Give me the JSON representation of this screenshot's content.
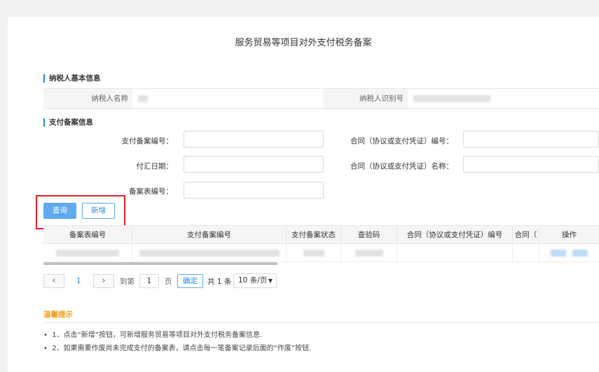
{
  "page": {
    "title": "服务贸易等项目对外支付税务备案"
  },
  "taxpayer": {
    "section_title": "纳税人基本信息",
    "name_label": "纳税人名称",
    "id_label": "纳税人识别号"
  },
  "payment": {
    "section_title": "支付备案信息",
    "fields": {
      "filing_no_label": "支付备案编号：",
      "contract_no_label": "合同（协议或支付凭证）编号：",
      "remit_date_label": "付汇日期：",
      "contract_name_label": "合同（协议或支付凭证）名称：",
      "form_no_label": "备案表编号："
    },
    "buttons": {
      "query": "查询",
      "add": "新增"
    }
  },
  "table": {
    "headers": [
      "备案表编号",
      "支付备案编号",
      "支付备案状态",
      "查验码",
      "合同（协议或支付凭证）编号",
      "合同（",
      "操作"
    ]
  },
  "pager": {
    "prev_icon": "chevron-left-icon",
    "next_icon": "chevron-right-icon",
    "current_page": "1",
    "goto_label": "到第",
    "goto_value": "1",
    "page_suffix": "页",
    "confirm": "确定",
    "total": "共 1 条",
    "page_size": "10 条/页"
  },
  "tips": {
    "title": "温馨提示",
    "items": [
      "1、点击“新增”按钮，可新增服务贸易等项目对外支付税务备案信息.",
      "2、如果需要作废尚未完成支付的备案表，请点击每一笔备案记录后面的“作废”按钮."
    ]
  },
  "colors": {
    "accent": "#5ea9f0",
    "highlight": "#e02020",
    "tips": "#f39c12"
  }
}
